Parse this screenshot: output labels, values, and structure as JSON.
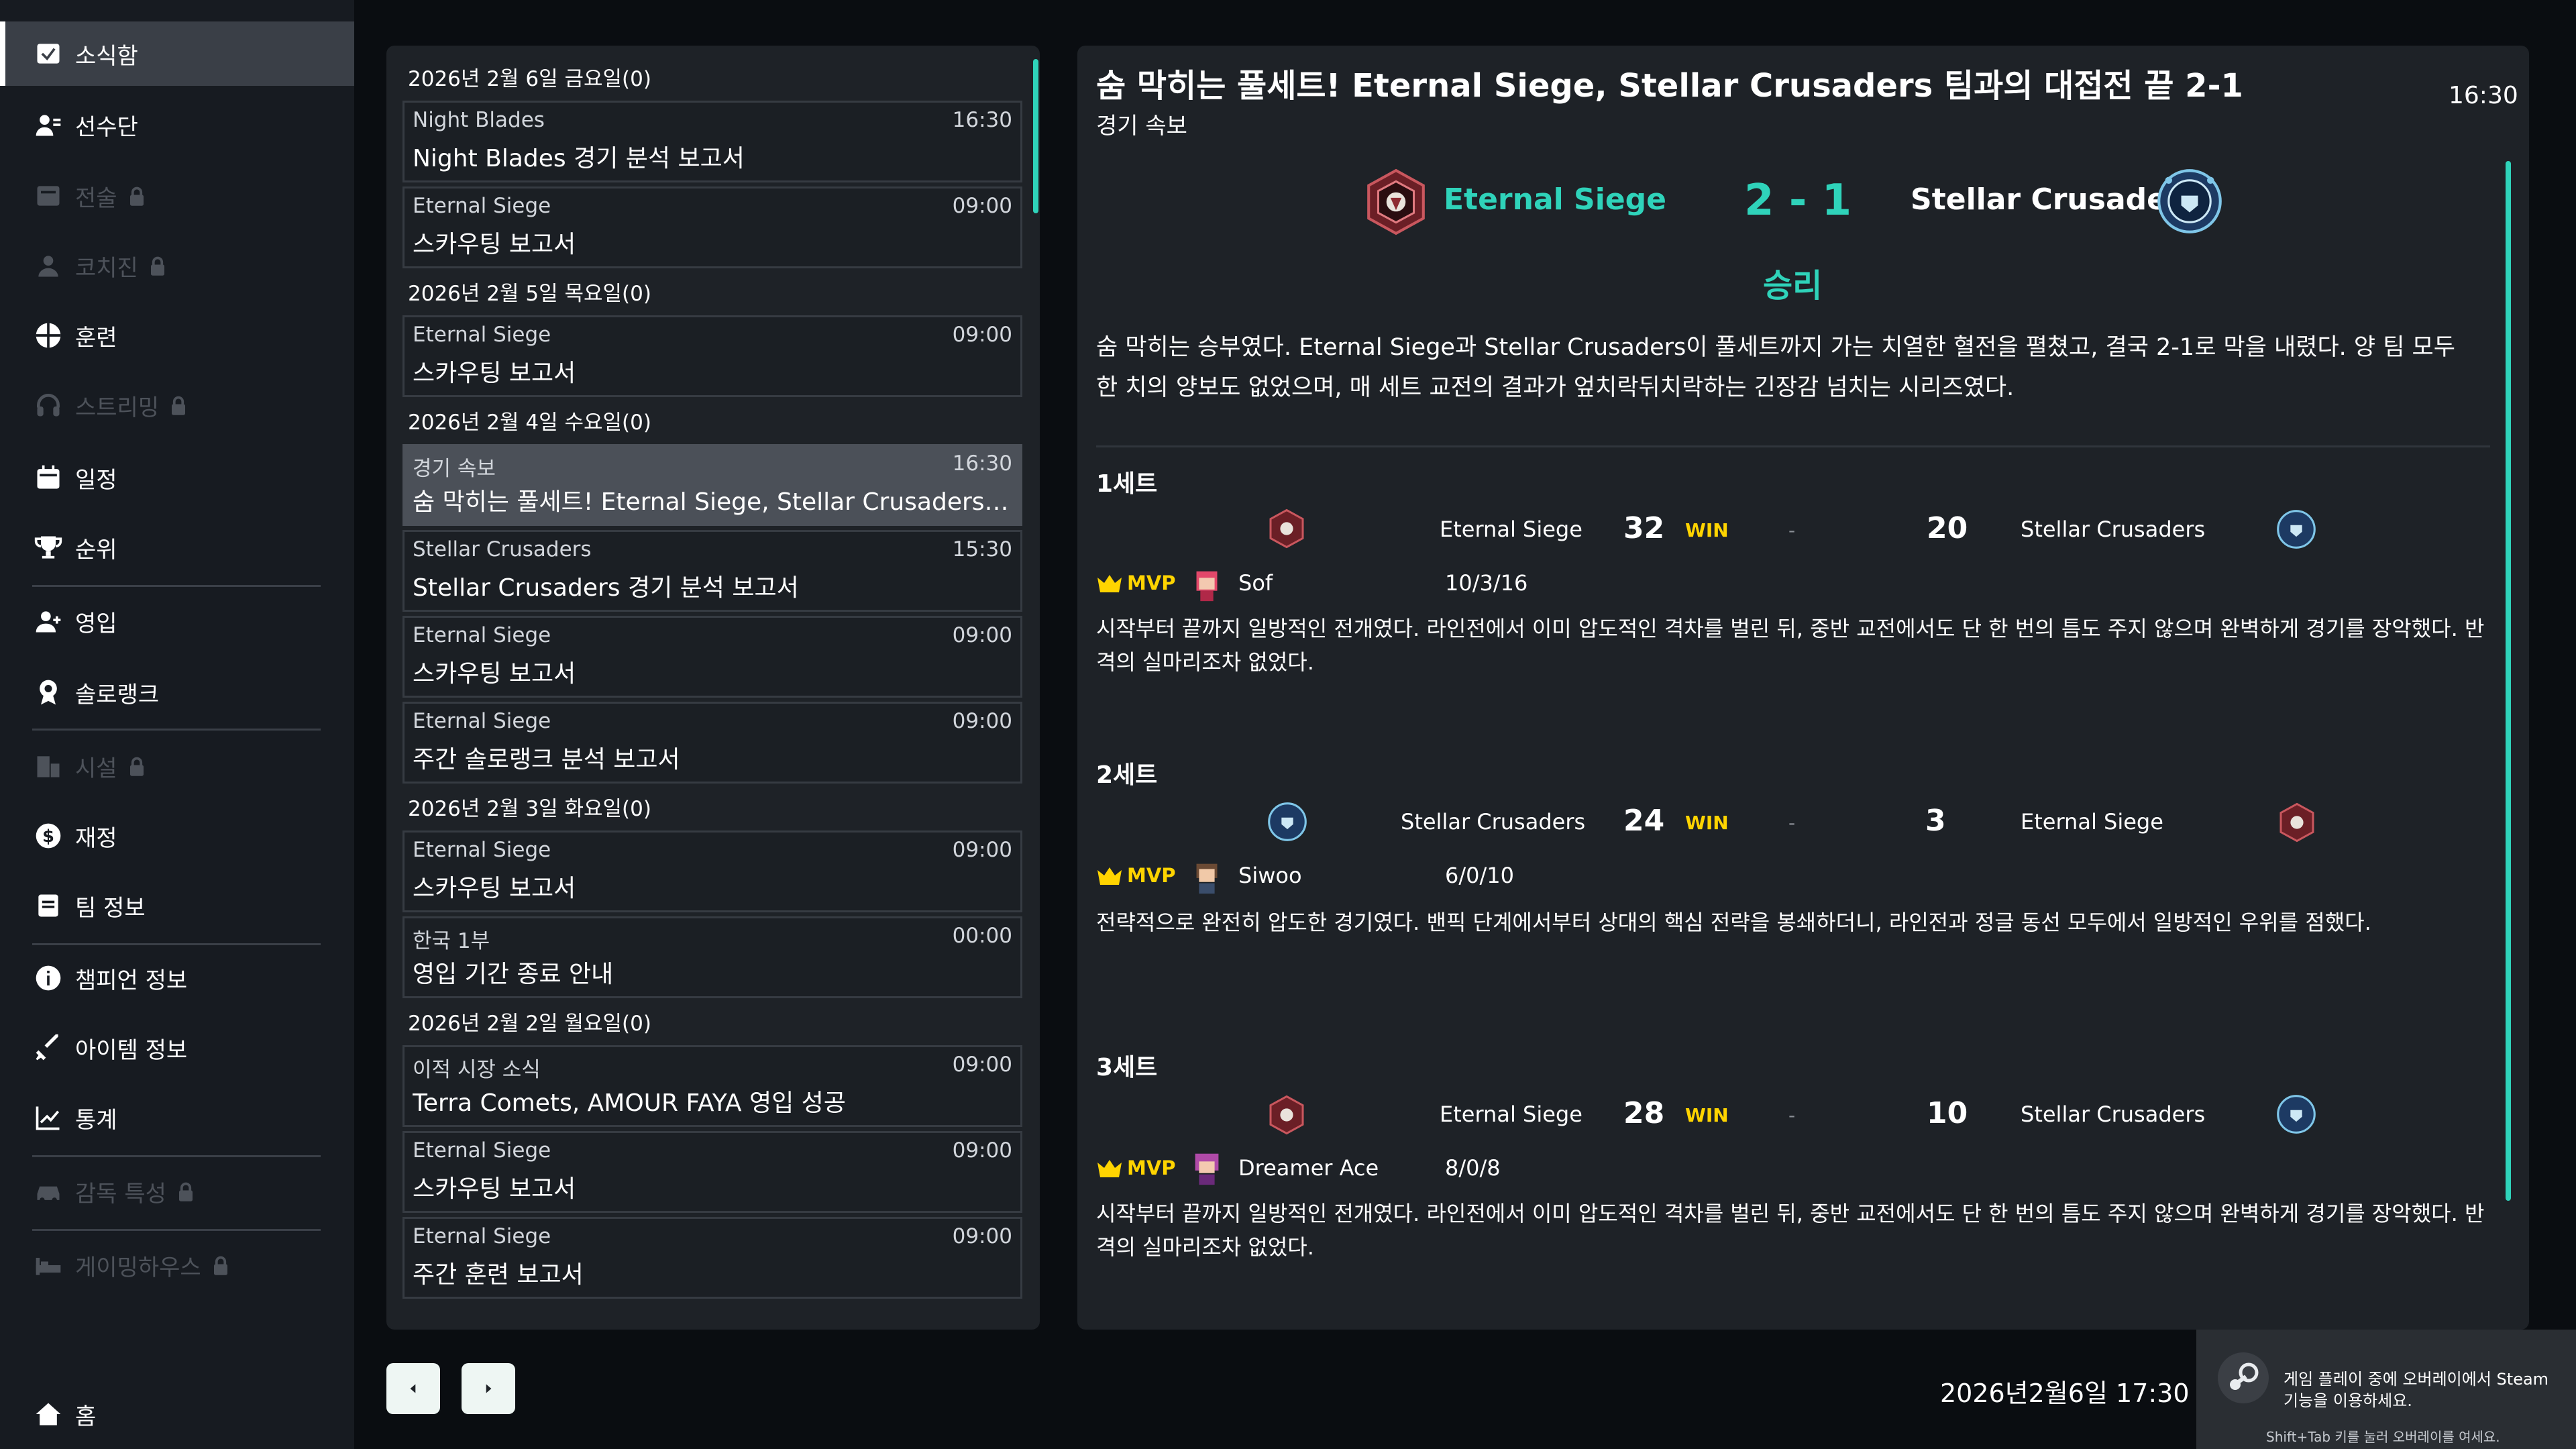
{
  "sidebar": {
    "items": [
      {
        "label": "소식함",
        "icon": "mail-icon",
        "active": true,
        "locked": false
      },
      {
        "label": "선수단",
        "icon": "players-icon",
        "active": false,
        "locked": false
      },
      {
        "label": "전술",
        "icon": "tactics-icon",
        "active": false,
        "locked": true
      },
      {
        "label": "코치진",
        "icon": "coach-icon",
        "active": false,
        "locked": true
      },
      {
        "label": "훈련",
        "icon": "training-icon",
        "active": false,
        "locked": false
      },
      {
        "label": "스트리밍",
        "icon": "headset-icon",
        "active": false,
        "locked": true
      },
      {
        "label": "일정",
        "icon": "calendar-icon",
        "active": false,
        "locked": false
      },
      {
        "label": "순위",
        "icon": "trophy-icon",
        "active": false,
        "locked": false
      },
      {
        "label": "영입",
        "icon": "recruit-icon",
        "active": false,
        "locked": false
      },
      {
        "label": "솔로랭크",
        "icon": "medal-icon",
        "active": false,
        "locked": false
      },
      {
        "label": "시설",
        "icon": "building-icon",
        "active": false,
        "locked": true
      },
      {
        "label": "재정",
        "icon": "money-icon",
        "active": false,
        "locked": false
      },
      {
        "label": "팀 정보",
        "icon": "team-info-icon",
        "active": false,
        "locked": false
      },
      {
        "label": "챔피언 정보",
        "icon": "info-icon",
        "active": false,
        "locked": false
      },
      {
        "label": "아이템 정보",
        "icon": "sword-icon",
        "active": false,
        "locked": false
      },
      {
        "label": "통계",
        "icon": "chart-icon",
        "active": false,
        "locked": false
      },
      {
        "label": "감독 특성",
        "icon": "car-icon",
        "active": false,
        "locked": true
      },
      {
        "label": "게이밍하우스",
        "icon": "bed-icon",
        "active": false,
        "locked": true
      }
    ],
    "home": {
      "label": "홈",
      "icon": "home-icon"
    }
  },
  "inbox": {
    "groups": [
      {
        "date": "2026년 2월 6일 금요일(0)",
        "messages": [
          {
            "sender": "Night Blades",
            "time": "16:30",
            "title": "Night Blades 경기 분석 보고서"
          },
          {
            "sender": "Eternal Siege",
            "time": "09:00",
            "title": "스카우팅 보고서"
          }
        ]
      },
      {
        "date": "2026년 2월 5일 목요일(0)",
        "messages": [
          {
            "sender": "Eternal Siege",
            "time": "09:00",
            "title": "스카우팅 보고서"
          }
        ]
      },
      {
        "date": "2026년 2월 4일 수요일(0)",
        "messages": [
          {
            "sender": "경기 속보",
            "time": "16:30",
            "title": "숨 막히는 풀세트! Eternal Siege, Stellar Crusaders 팀과...",
            "selected": true
          },
          {
            "sender": "Stellar Crusaders",
            "time": "15:30",
            "title": "Stellar Crusaders 경기 분석 보고서"
          },
          {
            "sender": "Eternal Siege",
            "time": "09:00",
            "title": "스카우팅 보고서"
          },
          {
            "sender": "Eternal Siege",
            "time": "09:00",
            "title": "주간 솔로랭크 분석 보고서"
          }
        ]
      },
      {
        "date": "2026년 2월 3일 화요일(0)",
        "messages": [
          {
            "sender": "Eternal Siege",
            "time": "09:00",
            "title": "스카우팅 보고서"
          },
          {
            "sender": "한국 1부",
            "time": "00:00",
            "title": "영입 기간 종료 안내"
          }
        ]
      },
      {
        "date": "2026년 2월 2일 월요일(0)",
        "messages": [
          {
            "sender": "이적 시장 소식",
            "time": "09:00",
            "title": "Terra Comets, AMOUR FAYA 영입 성공"
          },
          {
            "sender": "Eternal Siege",
            "time": "09:00",
            "title": "스카우팅 보고서"
          },
          {
            "sender": "Eternal Siege",
            "time": "09:00",
            "title": "주간 훈련 보고서"
          }
        ]
      }
    ]
  },
  "detail": {
    "title": "숨 막히는 풀세트! Eternal Siege, Stellar Crusaders 팀과의 대접전 끝 2-1",
    "category": "경기 속보",
    "time": "16:30",
    "home_team": "Eternal Siege",
    "away_team": "Stellar Crusaders",
    "score": "2 - 1",
    "result": "승리",
    "summary": "숨 막히는 승부였다. Eternal Siege과 Stellar Crusaders이 풀세트까지 가는 치열한 혈전을 펼쳤고, 결국 2-1로 막을 내렸다. 양 팀 모두 한 치의 양보도 없었으며, 매 세트 교전의 결과가 엎치락뒤치락하는 긴장감 넘치는 시리즈였다.",
    "sets": [
      {
        "label": "1세트",
        "left_team": "Eternal Siege",
        "left_score": "32",
        "win": "WIN",
        "dash": "-",
        "right_score": "20",
        "right_team": "Stellar Crusaders",
        "mvp": "MVP",
        "player": "Sof",
        "kda": "10/3/16",
        "desc": "시작부터 끝까지 일방적인 전개였다. 라인전에서 이미 압도적인 격차를 벌린 뒤, 중반 교전에서도 단 한 번의 틈도 주지 않으며 완벽하게 경기를 장악했다. 반격의 실마리조차 없었다."
      },
      {
        "label": "2세트",
        "left_team": "Stellar Crusaders",
        "left_score": "24",
        "win": "WIN",
        "dash": "-",
        "right_score": "3",
        "right_team": "Eternal Siege",
        "mvp": "MVP",
        "player": "Siwoo",
        "kda": "6/0/10",
        "desc": "전략적으로 완전히 압도한 경기였다. 밴픽 단계에서부터 상대의 핵심 전략을 봉쇄하더니, 라인전과 정글 동선 모두에서 일방적인 우위를 점했다."
      },
      {
        "label": "3세트",
        "left_team": "Eternal Siege",
        "left_score": "28",
        "win": "WIN",
        "dash": "-",
        "right_score": "10",
        "right_team": "Stellar Crusaders",
        "mvp": "MVP",
        "player": "Dreamer Ace",
        "kda": "8/0/8",
        "desc": "시작부터 끝까지 일방적인 전개였다. 라인전에서 이미 압도적인 격차를 벌린 뒤, 중반 교전에서도 단 한 번의 틈도 주지 않으며 완벽하게 경기를 장악했다. 반격의 실마리조차 없었다."
      }
    ]
  },
  "footer": {
    "clock": "2026년2월6일 17:30"
  },
  "toast": {
    "line1": "게임 플레이 중에 오버레이에서 Steam",
    "line2": "기능을 이용하세요.",
    "hint": "Shift+Tab 키를 눌러 오버레이를 여세요."
  },
  "colors": {
    "accent": "#2fd3ba",
    "win": "#ffd400",
    "home_team": "#2fd3ba"
  }
}
